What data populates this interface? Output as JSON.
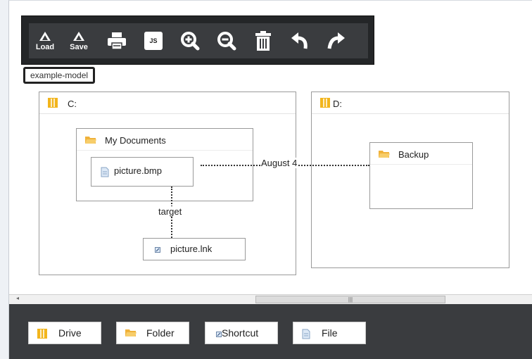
{
  "toolbar": {
    "load_label": "Load",
    "save_label": "Save",
    "js_label": "JS"
  },
  "model_name": "example-model",
  "drives": [
    {
      "label": "C:"
    },
    {
      "label": "D:"
    }
  ],
  "folders": [
    {
      "label": "My Documents"
    },
    {
      "label": "Backup"
    }
  ],
  "files": [
    {
      "label": "picture.bmp"
    }
  ],
  "shortcuts": [
    {
      "label": "picture.lnk"
    }
  ],
  "links": [
    {
      "label": "August 4"
    },
    {
      "label": "target"
    }
  ],
  "palette": {
    "drive": "Drive",
    "folder": "Folder",
    "shortcut": "Shortcut",
    "file": "File"
  },
  "colors": {
    "drive_icon": "#f2b51c",
    "folder_icon": "#f0b23a",
    "toolbar_bg": "#242628"
  }
}
